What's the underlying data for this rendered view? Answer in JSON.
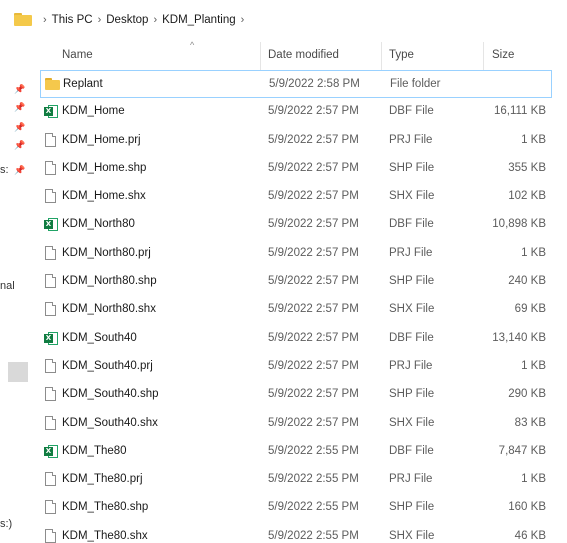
{
  "breadcrumb": {
    "items": [
      "This PC",
      "Desktop",
      "KDM_Planting"
    ],
    "separator": "›"
  },
  "sidebar": {
    "fragments": [
      "s:",
      "nal",
      "s:)"
    ]
  },
  "columns": {
    "name": "Name",
    "date": "Date modified",
    "type": "Type",
    "size": "Size"
  },
  "files": [
    {
      "name": "Replant",
      "date": "5/9/2022 2:58 PM",
      "type": "File folder",
      "size": "",
      "icon": "folder-icon"
    },
    {
      "name": "KDM_Home",
      "date": "5/9/2022 2:57 PM",
      "type": "DBF File",
      "size": "16,111 KB",
      "icon": "excel-icon"
    },
    {
      "name": "KDM_Home.prj",
      "date": "5/9/2022 2:57 PM",
      "type": "PRJ File",
      "size": "1 KB",
      "icon": "file-icon"
    },
    {
      "name": "KDM_Home.shp",
      "date": "5/9/2022 2:57 PM",
      "type": "SHP File",
      "size": "355 KB",
      "icon": "file-icon"
    },
    {
      "name": "KDM_Home.shx",
      "date": "5/9/2022 2:57 PM",
      "type": "SHX File",
      "size": "102 KB",
      "icon": "file-icon"
    },
    {
      "name": "KDM_North80",
      "date": "5/9/2022 2:57 PM",
      "type": "DBF File",
      "size": "10,898 KB",
      "icon": "excel-icon"
    },
    {
      "name": "KDM_North80.prj",
      "date": "5/9/2022 2:57 PM",
      "type": "PRJ File",
      "size": "1 KB",
      "icon": "file-icon"
    },
    {
      "name": "KDM_North80.shp",
      "date": "5/9/2022 2:57 PM",
      "type": "SHP File",
      "size": "240 KB",
      "icon": "file-icon"
    },
    {
      "name": "KDM_North80.shx",
      "date": "5/9/2022 2:57 PM",
      "type": "SHX File",
      "size": "69 KB",
      "icon": "file-icon"
    },
    {
      "name": "KDM_South40",
      "date": "5/9/2022 2:57 PM",
      "type": "DBF File",
      "size": "13,140 KB",
      "icon": "excel-icon"
    },
    {
      "name": "KDM_South40.prj",
      "date": "5/9/2022 2:57 PM",
      "type": "PRJ File",
      "size": "1 KB",
      "icon": "file-icon"
    },
    {
      "name": "KDM_South40.shp",
      "date": "5/9/2022 2:57 PM",
      "type": "SHP File",
      "size": "290 KB",
      "icon": "file-icon"
    },
    {
      "name": "KDM_South40.shx",
      "date": "5/9/2022 2:57 PM",
      "type": "SHX File",
      "size": "83 KB",
      "icon": "file-icon"
    },
    {
      "name": "KDM_The80",
      "date": "5/9/2022 2:55 PM",
      "type": "DBF File",
      "size": "7,847 KB",
      "icon": "excel-icon"
    },
    {
      "name": "KDM_The80.prj",
      "date": "5/9/2022 2:55 PM",
      "type": "PRJ File",
      "size": "1 KB",
      "icon": "file-icon"
    },
    {
      "name": "KDM_The80.shp",
      "date": "5/9/2022 2:55 PM",
      "type": "SHP File",
      "size": "160 KB",
      "icon": "file-icon"
    },
    {
      "name": "KDM_The80.shx",
      "date": "5/9/2022 2:55 PM",
      "type": "SHX File",
      "size": "46 KB",
      "icon": "file-icon"
    }
  ],
  "colors": {
    "selection_border": "#99d1ff",
    "folder": "#f5c84c",
    "excel": "#107c41"
  }
}
